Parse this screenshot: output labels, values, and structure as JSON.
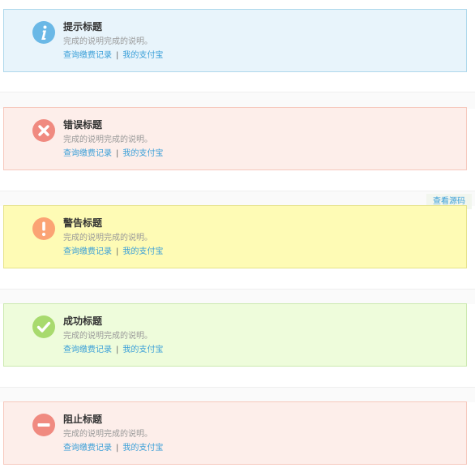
{
  "alerts": [
    {
      "title": "提示标题",
      "desc": "完成的说明完成的说明。",
      "link1": "查询缴费记录",
      "separator": "|",
      "link2": "我的支付宝",
      "icon": "info-icon",
      "bg": "#e8f4fb",
      "border": "#aed8ec",
      "icon_color": "#6ab8e6"
    },
    {
      "title": "错误标题",
      "desc": "完成的说明完成的说明。",
      "link1": "查询缴费记录",
      "separator": "|",
      "link2": "我的支付宝",
      "icon": "error-icon",
      "bg": "#fdeeea",
      "border": "#f6c8bd",
      "icon_color": "#f08a80"
    },
    {
      "title": "警告标题",
      "desc": "完成的说明完成的说明。",
      "link1": "查询缴费记录",
      "separator": "|",
      "link2": "我的支付宝",
      "icon": "warning-icon",
      "bg": "#fefbb5",
      "border": "#e6e38a",
      "icon_color": "#fba374"
    },
    {
      "title": "成功标题",
      "desc": "完成的说明完成的说明。",
      "link1": "查询缴费记录",
      "separator": "|",
      "link2": "我的支付宝",
      "icon": "success-icon",
      "bg": "#eefcdb",
      "border": "#cce9b0",
      "icon_color": "#a8da6e"
    },
    {
      "title": "阻止标题",
      "desc": "完成的说明完成的说明。",
      "link1": "查询缴费记录",
      "separator": "|",
      "link2": "我的支付宝",
      "icon": "block-icon",
      "bg": "#fdeeea",
      "border": "#f6c8bd",
      "icon_color": "#f08a80"
    }
  ],
  "view_source_label": "查看源码"
}
